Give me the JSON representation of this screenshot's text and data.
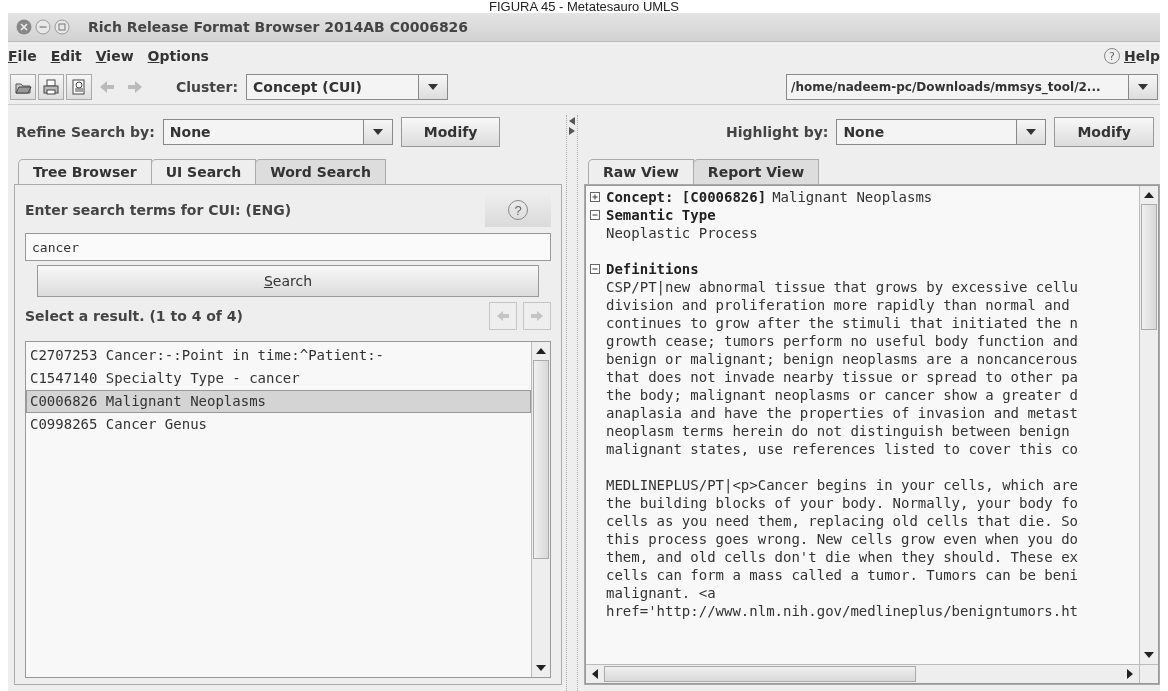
{
  "caption": "FIGURA 45 - Metatesauro UMLS",
  "window": {
    "title": "Rich Release Format Browser 2014AB C0006826"
  },
  "menu": [
    "File",
    "Edit",
    "View",
    "Options"
  ],
  "help_menu": {
    "icon": "?",
    "label": "Help"
  },
  "toolbar": {
    "tools": [
      {
        "kind": "open",
        "disabled": false
      },
      {
        "kind": "print",
        "disabled": false
      },
      {
        "kind": "preview",
        "disabled": false
      },
      {
        "kind": "back",
        "disabled": true
      },
      {
        "kind": "forward",
        "disabled": true
      }
    ],
    "cluster_label": "Cluster:",
    "cluster_value": "Concept (CUI)",
    "path_value": "/home/nadeem-pc/Downloads/mmsys_tool/2..."
  },
  "left": {
    "refine_label": "Refine Search by:",
    "refine_value": "None",
    "modify": "Modify",
    "tabs": [
      {
        "label": "Tree Browser",
        "selected": false
      },
      {
        "label": "UI Search",
        "selected": false
      },
      {
        "label": "Word Search",
        "selected": true
      }
    ],
    "prompt": "Enter search terms for CUI: (ENG)",
    "help": "?",
    "search_value": "cancer",
    "search_button": "Search",
    "results_label": "Select a result. (1 to 4 of 4)",
    "pager": [
      {
        "kind": "prev",
        "disabled": true
      },
      {
        "kind": "next",
        "disabled": true
      }
    ],
    "results": [
      {
        "text": "C2707253 Cancer:-:Point in time:^Patient:-",
        "selected": false
      },
      {
        "text": "C1547140 Specialty Type - cancer",
        "selected": false
      },
      {
        "text": "C0006826 Malignant Neoplasms",
        "selected": true
      },
      {
        "text": "C0998265 Cancer Genus",
        "selected": false
      }
    ]
  },
  "right": {
    "highlight_label": "Highlight by:",
    "highlight_value": "None",
    "modify": "Modify",
    "tabs": [
      {
        "label": "Raw View",
        "selected": false
      },
      {
        "label": "Report View",
        "selected": true
      }
    ],
    "report": [
      {
        "label": "Concept: [C0006826]",
        "value": "Malignant Neoplasms",
        "expanded": false
      },
      {
        "label": "Semantic Type",
        "expanded": true,
        "paragraphs": [
          [
            "Neoplastic Process"
          ]
        ]
      },
      {
        "label": "Definitions",
        "expanded": true,
        "paragraphs": [
          [
            "CSP/PT|new abnormal tissue that grows by excessive cellu",
            "division and proliferation more rapidly than normal and",
            "continues to grow after the stimuli that initiated the n",
            "growth cease; tumors perform no useful body function and",
            "benign or malignant; benign neoplasms are a noncancerous",
            "that does not invade nearby tissue or spread to other pa",
            "the body; malignant neoplasms or cancer show a greater d",
            "anaplasia and have the properties of invasion and metast",
            "neoplasm terms herein do not distinguish between benign",
            "malignant states, use references listed to cover this co"
          ],
          [
            "MEDLINEPLUS/PT|<p>Cancer begins in your cells, which are",
            "the building blocks of your body. Normally, your body fo",
            "cells as you need them, replacing old cells that die. So",
            "this process goes wrong. New cells grow even when you do",
            "them, and old cells don't die when they should. These ex",
            "cells can form a mass called a tumor. Tumors can be beni",
            "malignant. <a",
            "href='http://www.nlm.nih.gov/medlineplus/benigntumors.ht"
          ]
        ]
      }
    ]
  }
}
